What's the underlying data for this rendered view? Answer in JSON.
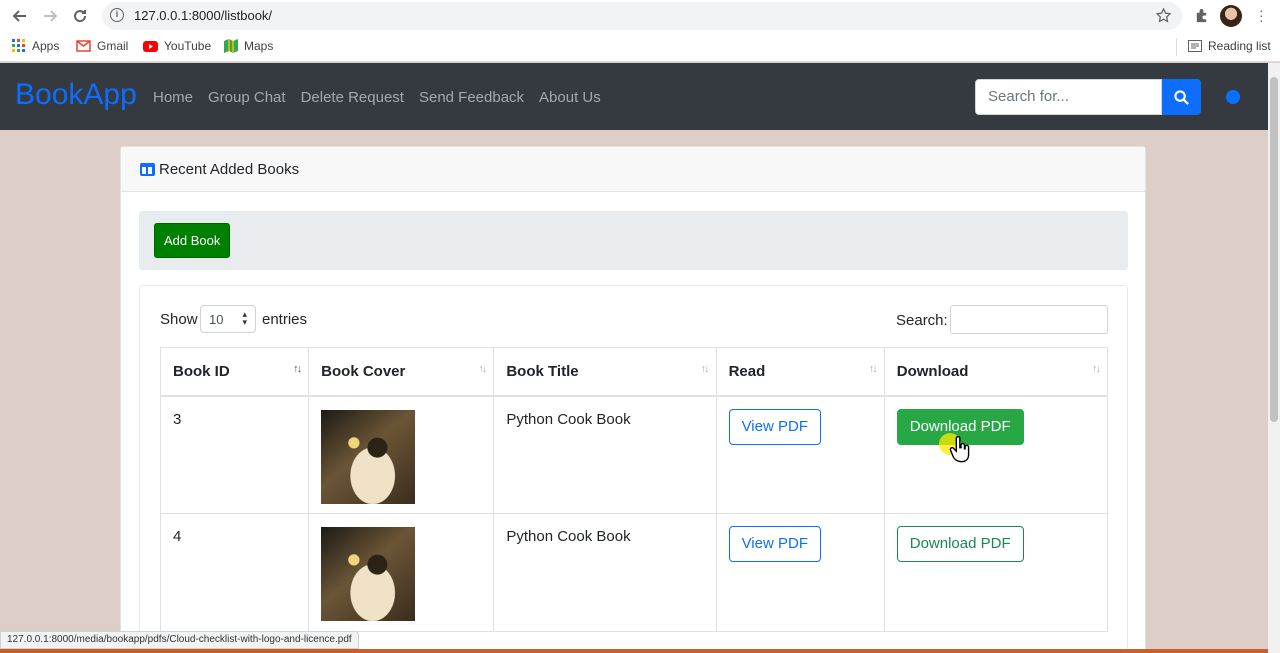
{
  "browser": {
    "url": "127.0.0.1:8000/listbook/",
    "bookmarks": [
      {
        "label": "Apps",
        "icon": "apps-grid-icon"
      },
      {
        "label": "Gmail",
        "icon": "gmail-icon"
      },
      {
        "label": "YouTube",
        "icon": "youtube-icon"
      },
      {
        "label": "Maps",
        "icon": "maps-icon"
      }
    ],
    "reading_list": "Reading list",
    "status_url": "127.0.0.1:8000/media/bookapp/pdfs/Cloud-checklist-with-logo-and-licence.pdf"
  },
  "navbar": {
    "brand": "BookApp",
    "links": [
      "Home",
      "Group Chat",
      "Delete Request",
      "Send Feedback",
      "About Us"
    ],
    "search_placeholder": "Search for...",
    "accent_color": "#0d6efd",
    "background": "#343a40"
  },
  "card": {
    "title": "Recent Added Books",
    "add_button": "Add Book",
    "show_label": "Show",
    "entries_value": "10",
    "entries_label": "entries",
    "search_label": "Search:"
  },
  "table": {
    "headers": [
      "Book ID",
      "Book Cover",
      "Book Title",
      "Read",
      "Download"
    ],
    "rows": [
      {
        "id": "3",
        "title": "Python Cook Book",
        "read": "View PDF",
        "download": "Download PDF"
      },
      {
        "id": "4",
        "title": "Python Cook Book",
        "read": "View PDF",
        "download": "Download PDF"
      }
    ]
  }
}
